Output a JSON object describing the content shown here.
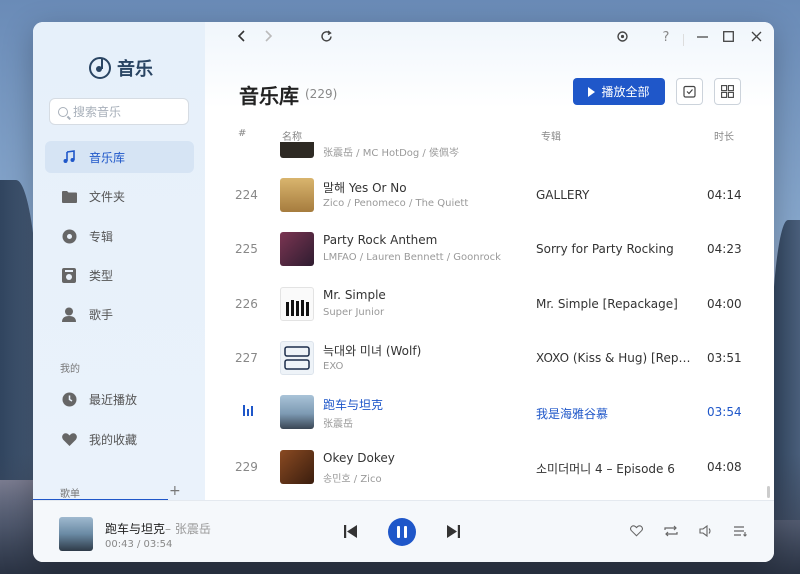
{
  "app": {
    "name": "音乐"
  },
  "search": {
    "placeholder": "搜索音乐"
  },
  "sidebar": {
    "items": [
      {
        "label": "音乐库",
        "icon": "music-note-icon",
        "active": true
      },
      {
        "label": "文件夹",
        "icon": "folder-icon"
      },
      {
        "label": "专辑",
        "icon": "album-icon"
      },
      {
        "label": "类型",
        "icon": "genre-icon"
      },
      {
        "label": "歌手",
        "icon": "artist-icon"
      }
    ],
    "mine_label": "我的",
    "mine_items": [
      {
        "label": "最近播放",
        "icon": "clock-icon"
      },
      {
        "label": "我的收藏",
        "icon": "heart-icon"
      }
    ],
    "playlist_label": "歌单",
    "add_label": "+"
  },
  "page": {
    "title": "音乐库",
    "count": "(229)",
    "play_all_label": "播放全部"
  },
  "columns": {
    "num": "#",
    "name": "名称",
    "album": "专辑",
    "duration": "时长"
  },
  "partial_row": {
    "artist": "张震岳 / MC HotDog / 侯佩岑"
  },
  "tracks": [
    {
      "num": "224",
      "title": "말해 Yes Or No",
      "artist": "Zico / Penomeco / The Quiett",
      "album": "GALLERY",
      "duration": "04:14",
      "cover": "#c9a35f"
    },
    {
      "num": "225",
      "title": "Party Rock Anthem",
      "artist": "LMFAO / Lauren Bennett / Goonrock",
      "album": "Sorry for Party Rocking",
      "duration": "04:23",
      "cover": "#5a2c4a"
    },
    {
      "num": "226",
      "title": "Mr. Simple",
      "artist": "Super Junior",
      "album": "Mr. Simple [Repackage]",
      "duration": "04:00",
      "cover": "#f2f2f2"
    },
    {
      "num": "227",
      "title": "늑대와 미녀 (Wolf)",
      "artist": "EXO",
      "album": "XOXO (Kiss & Hug) [Repa...",
      "duration": "03:51",
      "cover": "#e8eef5"
    },
    {
      "num": "",
      "title": "跑车与坦克",
      "artist": "张震岳",
      "album": "我是海雅谷慕",
      "duration": "03:54",
      "cover": "#8aa6bf",
      "playing": true
    },
    {
      "num": "229",
      "title": "Okey Dokey",
      "artist": "송민호 / Zico",
      "album": "소미더머니 4 – Episode 6",
      "duration": "04:08",
      "cover": "#6b3a1f"
    }
  ],
  "player": {
    "title": "跑车与坦克",
    "artist": "– 张震岳",
    "time": "00:43 / 03:54"
  },
  "accent_color": "#1f57c9"
}
